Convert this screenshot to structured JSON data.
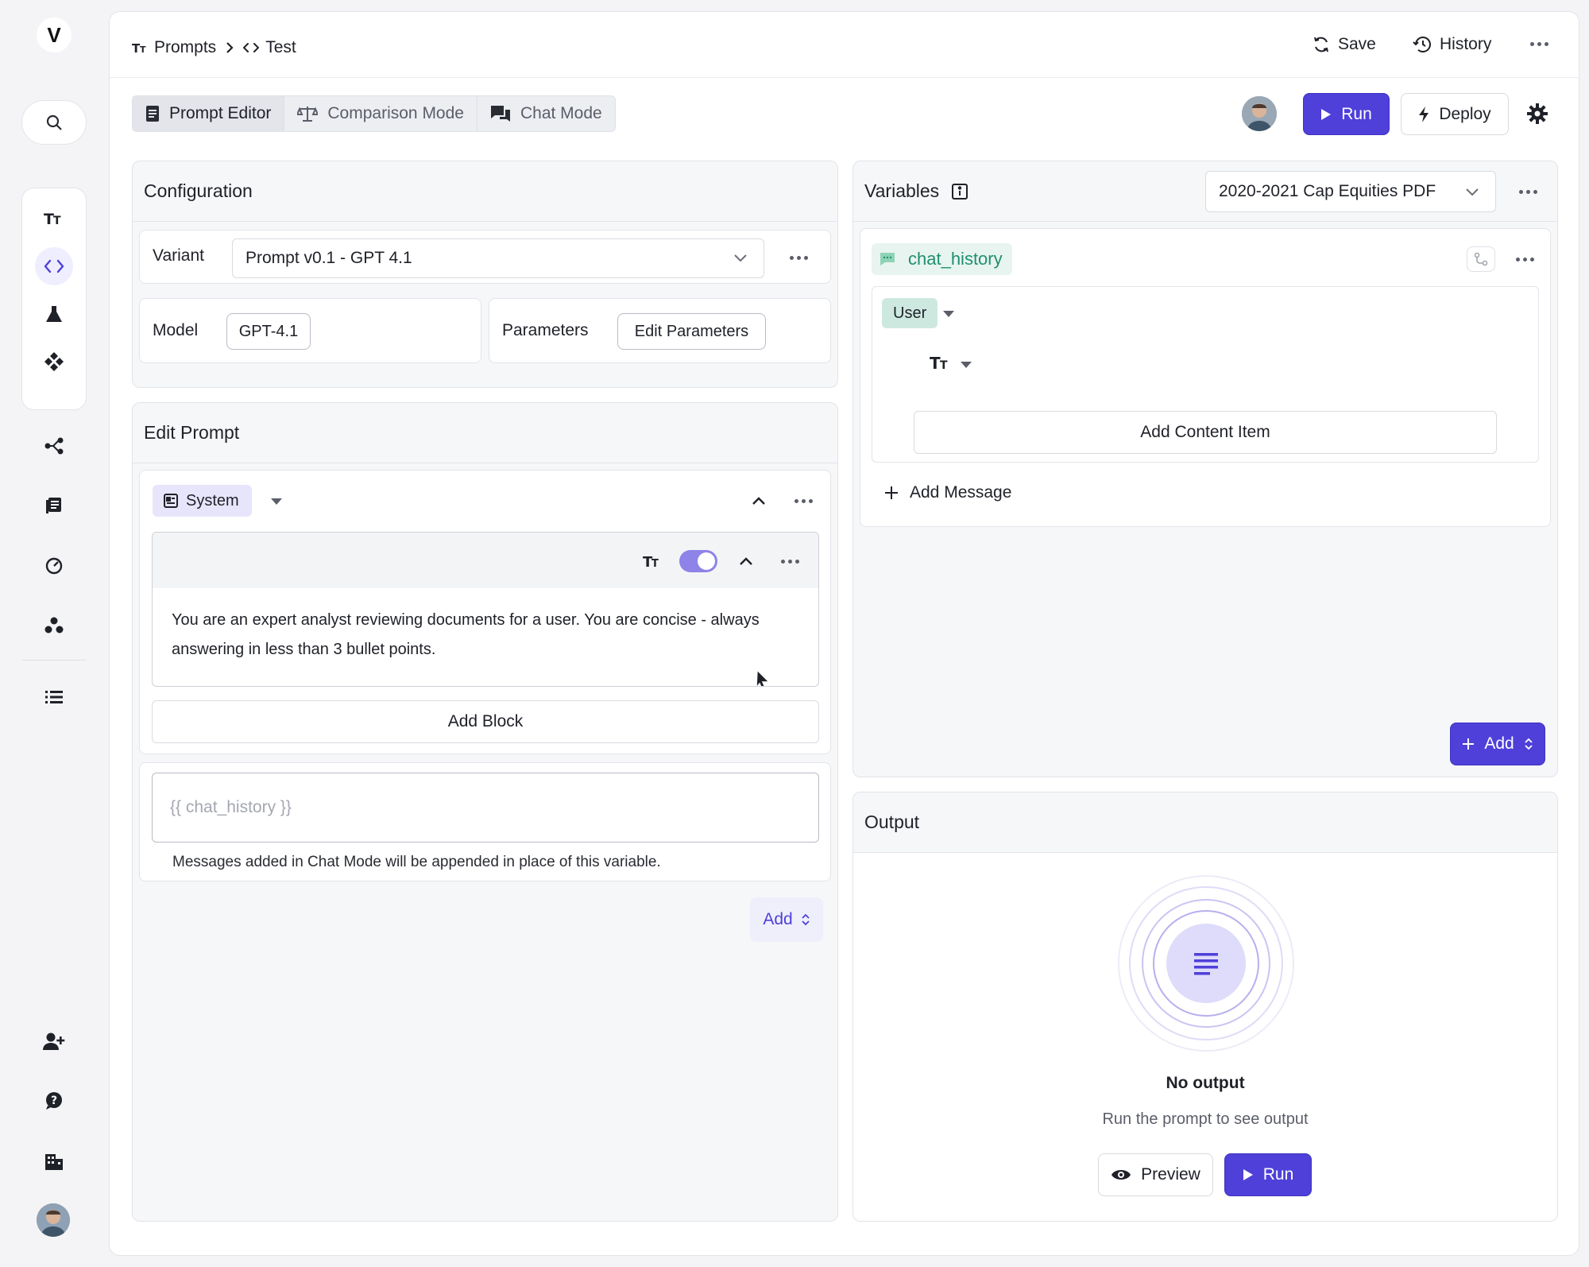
{
  "app": {
    "logo": "V"
  },
  "rail": {
    "icons": [
      "search-icon",
      "prompts-icon",
      "code-icon",
      "flask-icon",
      "components-icon",
      "workflow-icon",
      "library-icon",
      "gauge-icon",
      "cluster-icon",
      "list-icon",
      "add-user-icon",
      "help-icon",
      "building-icon",
      "avatar"
    ]
  },
  "breadcrumb": {
    "root": "Prompts",
    "current": "Test"
  },
  "topbar": {
    "save": "Save",
    "history": "History"
  },
  "tabs": [
    {
      "label": "Prompt Editor",
      "icon": "document-icon",
      "active": true
    },
    {
      "label": "Comparison Mode",
      "icon": "scale-icon",
      "active": false
    },
    {
      "label": "Chat Mode",
      "icon": "chat-icon",
      "active": false
    }
  ],
  "actions": {
    "run": "Run",
    "deploy": "Deploy"
  },
  "configuration": {
    "title": "Configuration",
    "variant_label": "Variant",
    "variant_value": "Prompt v0.1 - GPT 4.1",
    "model_label": "Model",
    "model_value": "GPT-4.1",
    "parameters_label": "Parameters",
    "parameters_button": "Edit Parameters"
  },
  "edit_prompt": {
    "title": "Edit Prompt",
    "role": "System",
    "block_text": "You are an expert analyst reviewing documents for a user. You are concise - always answering in less than 3 bullet points.",
    "add_block": "Add Block",
    "variable_placeholder": "{{ chat_history }}",
    "variable_hint": "Messages added in Chat Mode will be appended in place of this variable.",
    "add": "Add"
  },
  "variables": {
    "title": "Variables",
    "dataset": "2020-2021 Cap Equities PDF",
    "variable_name": "chat_history",
    "message_role": "User",
    "add_content_item": "Add Content Item",
    "add_message": "Add Message",
    "add": "Add"
  },
  "output": {
    "title": "Output",
    "empty_title": "No output",
    "empty_subtitle": "Run the prompt to see output",
    "preview": "Preview",
    "run": "Run"
  },
  "colors": {
    "accent": "#4e40d9",
    "variable_green": "#1f8f6f",
    "toggle": "#8d83e8"
  }
}
